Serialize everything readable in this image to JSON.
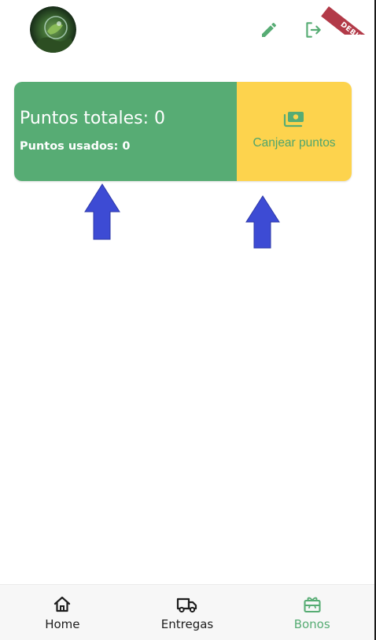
{
  "app": {
    "debug_banner": "DEBUG",
    "colors": {
      "primary_green": "#57ac74",
      "accent_yellow": "#fdd34d",
      "arrow_blue": "#3d4bd4"
    }
  },
  "header": {
    "avatar_alt": "Foto de perfil",
    "icons": {
      "edit": "pencil-icon",
      "logout": "logout-icon"
    }
  },
  "points_card": {
    "total_label": "Puntos totales: 0",
    "used_label": "Puntos usados: 0",
    "redeem_label": "Canjear puntos",
    "redeem_icon": "money-icon"
  },
  "bottom_nav": {
    "items": [
      {
        "label": "Home",
        "icon": "home-icon",
        "active": false
      },
      {
        "label": "Entregas",
        "icon": "truck-icon",
        "active": false
      },
      {
        "label": "Bonos",
        "icon": "gift-card-icon",
        "active": true
      }
    ]
  }
}
